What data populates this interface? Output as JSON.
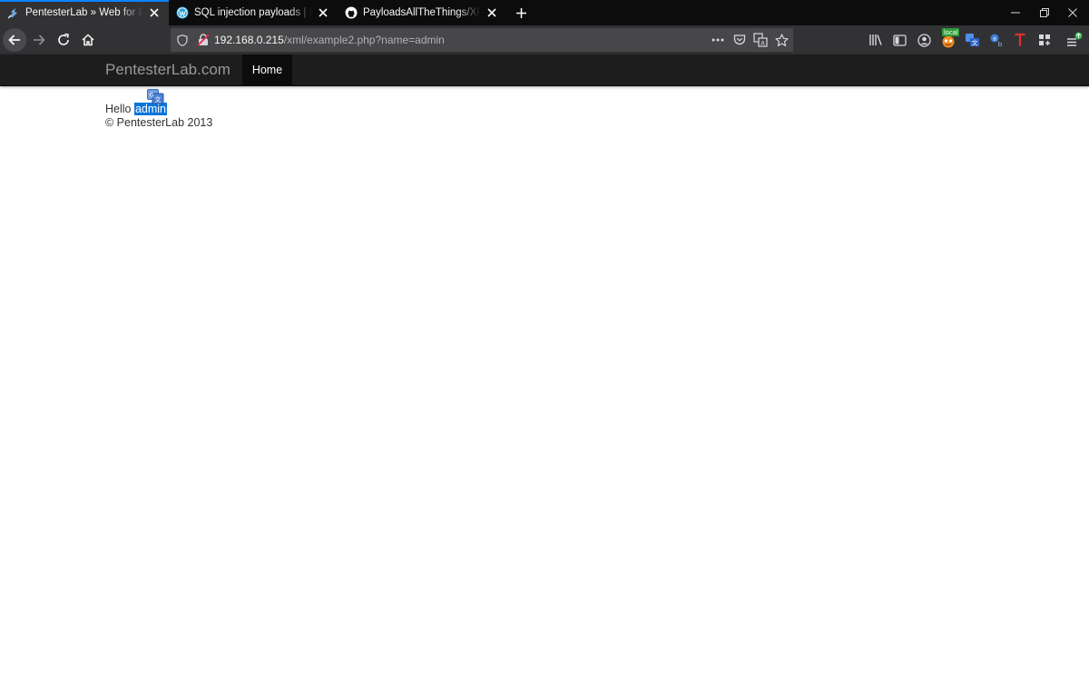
{
  "tabs": [
    {
      "title": "PentesterLab » Web for Pentester",
      "icon": "pentesterlab-favicon",
      "active": true
    },
    {
      "title": "SQL injection payloads | IT Security",
      "icon": "wordpress-favicon",
      "active": false
    },
    {
      "title": "PayloadsAllTheThings/XPATH Injection",
      "icon": "github-favicon",
      "active": false
    }
  ],
  "toolbar": {
    "url_host": "192.168.0.215",
    "url_path": "/xml/example2.php?name=admin",
    "ext_badge": "local"
  },
  "site": {
    "brand": "PentesterLab.com",
    "nav_home": "Home"
  },
  "main": {
    "greeting": "Hello ",
    "name_value": "admin",
    "footer": "© PentesterLab 2013"
  },
  "colors": {
    "tab_accent": "#0a84ff",
    "selection": "#0a76d9",
    "navbar": "#1d1d1d"
  }
}
